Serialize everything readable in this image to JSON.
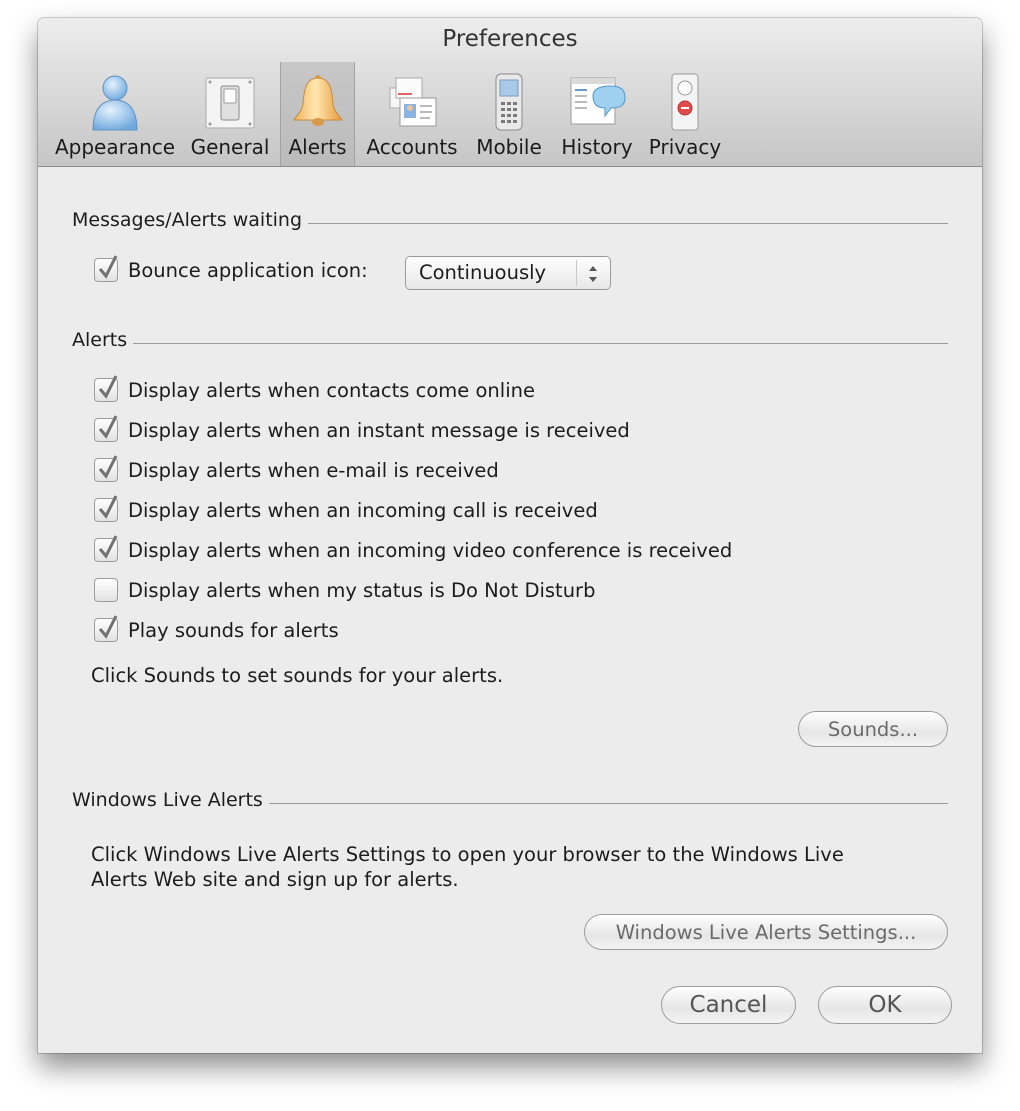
{
  "window": {
    "title": "Preferences"
  },
  "tabs": [
    {
      "label": "Appearance",
      "icon": "person-icon"
    },
    {
      "label": "General",
      "icon": "switch-icon"
    },
    {
      "label": "Alerts",
      "icon": "bell-icon",
      "selected": true
    },
    {
      "label": "Accounts",
      "icon": "accounts-icon"
    },
    {
      "label": "Mobile",
      "icon": "phone-icon"
    },
    {
      "label": "History",
      "icon": "history-icon"
    },
    {
      "label": "Privacy",
      "icon": "privacy-icon"
    }
  ],
  "messages_section": {
    "title": "Messages/Alerts waiting",
    "bounce": {
      "label": "Bounce application icon:",
      "checked": true
    },
    "bounce_select": {
      "value": "Continuously"
    }
  },
  "alerts_section": {
    "title": "Alerts",
    "options": [
      {
        "label": "Display alerts when contacts come online",
        "checked": true
      },
      {
        "label": "Display alerts when an instant message is received",
        "checked": true
      },
      {
        "label": "Display alerts when e-mail is received",
        "checked": true
      },
      {
        "label": "Display alerts when an incoming call is received",
        "checked": true
      },
      {
        "label": "Display alerts when an incoming video conference is received",
        "checked": true
      },
      {
        "label": "Display alerts when my status is Do Not Disturb",
        "checked": false
      },
      {
        "label": "Play sounds for alerts",
        "checked": true
      }
    ],
    "hint": "Click Sounds to set sounds for your alerts.",
    "sounds_button": "Sounds..."
  },
  "live_section": {
    "title": "Windows Live Alerts",
    "description_line1": "Click Windows Live Alerts Settings to open your browser to the Windows Live",
    "description_line2": "Alerts Web site and sign up for alerts.",
    "settings_button": "Windows Live Alerts Settings..."
  },
  "footer": {
    "cancel": "Cancel",
    "ok": "OK"
  },
  "colors": {
    "window_bg": "#ececec",
    "toolbar_top": "#ededed",
    "toolbar_bottom": "#c6c6c6",
    "check": "#707070"
  }
}
